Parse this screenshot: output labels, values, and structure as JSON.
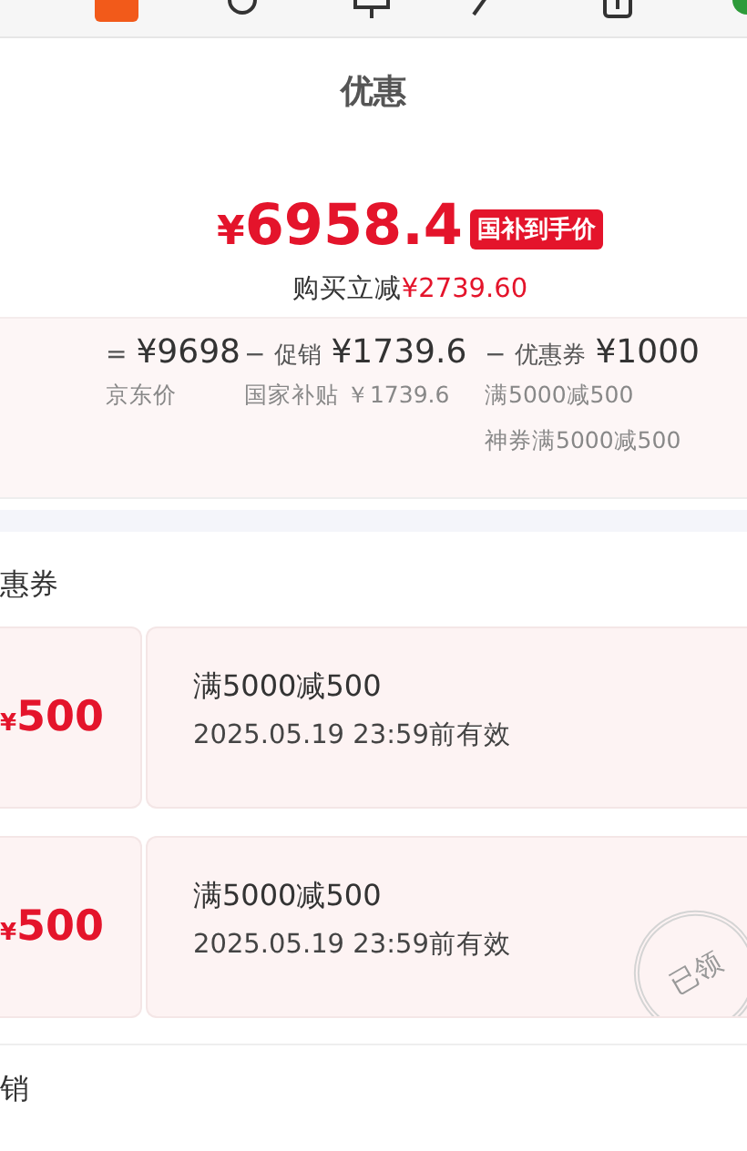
{
  "header": {
    "title": "优惠"
  },
  "price": {
    "currency": "¥",
    "amount": "6958.4",
    "badge": "国补到手价",
    "saving_label": "购买立减",
    "saving_amount": "¥2739.60"
  },
  "breakdown": [
    {
      "operator": "=",
      "amount": "¥9698",
      "notes": [
        "京东价"
      ]
    },
    {
      "operator": "−",
      "label": "促销",
      "amount": "¥1739.6",
      "notes": [
        "国家补贴 ￥1739.6"
      ]
    },
    {
      "operator": "−",
      "label": "优惠券",
      "amount": "¥1000",
      "notes": [
        "满5000减500",
        "神券满5000减500"
      ]
    }
  ],
  "coupon_section": {
    "title": "惠券",
    "coupons": [
      {
        "currency": "¥",
        "value": "500",
        "condition": "满5000减500",
        "validity": "2025.05.19 23:59前有效"
      },
      {
        "currency": "¥",
        "value": "500",
        "condition": "满5000减500",
        "validity": "2025.05.19 23:59前有效",
        "stamp": "已领"
      }
    ]
  },
  "next_section": {
    "title": "销"
  }
}
